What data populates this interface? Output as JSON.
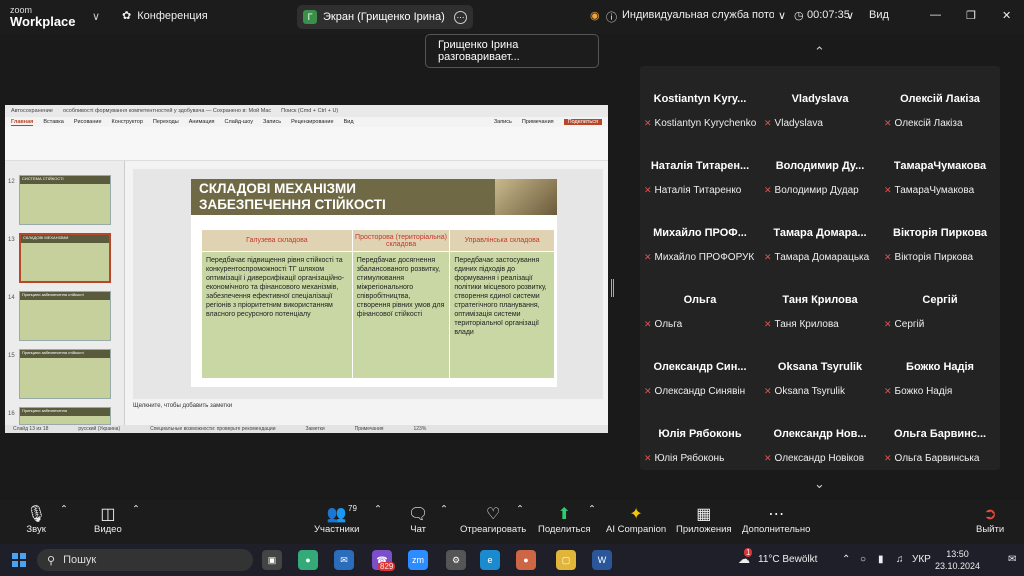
{
  "app": {
    "logo_top": "zoom",
    "logo_bottom": "Workplace",
    "meeting": "Конференция"
  },
  "screen_pill": {
    "label": "Экран (Грищенко Ірина)",
    "avatar": "Г"
  },
  "topright": {
    "service": "Индивидуальная служба потоково...",
    "timer": "00:07:35",
    "view": "Вид"
  },
  "speaking": "Грищенко Ірина разговаривает...",
  "ppt": {
    "autosave": "Автосохранение",
    "doc_title": "особливості формування компетентностей у здобувача — Сохранено в: Мой Mac",
    "search": "Поиск (Cmd + Ctrl + U)",
    "tabs": [
      "Главная",
      "Вставка",
      "Рисование",
      "Конструктор",
      "Переходы",
      "Анимация",
      "Слайд-шоу",
      "Запись",
      "Рецензирование",
      "Вид"
    ],
    "record": "Запись",
    "notes_btn": "Примечания",
    "share_btn": "Поделиться",
    "thumb_nums": [
      "12",
      "13",
      "14",
      "15",
      "16"
    ],
    "thumb_titles": [
      "СИСТЕМА СТІЙКОСТІ",
      "СКЛАДОВІ МЕХАНІЗМИ",
      "Принципи забезпечення стійкості",
      "Принципи забезпечення стійкості",
      "Принципи забезпечення"
    ],
    "slide_title": "СКЛАДОВІ МЕХАНІЗМИ ЗАБЕЗПЕЧЕННЯ СТІЙКОСТІ",
    "table_headers": [
      "Галузева складова",
      "Просторова (територіальна) складова",
      "Управлінська складова"
    ],
    "table_cells": [
      "Передбачає підвищення рівня стійкості та конкурентоспроможності ТГ шляхом оптимізації і диверсифікації організаційно-економічного та фінансового механізмів, забезпечення ефективної спеціалізації регіонів з пріоритетним використанням власного ресурсного потенціалу",
      "Передбачає досягнення збалансованого розвитку, стимулювання міжрегіонального співробітництва, створення рівних умов для фінансової стійкості",
      "Передбачає застосування єдиних підходів до формування і реалізації політики місцевого розвитку, створення єдиної системи стратегічного планування, оптимізація системи територіальної організації влади"
    ],
    "notes_hint": "Щелкните, чтобы добавить заметки",
    "status_slide": "Слайд 13 из 18",
    "status_lang": "русский (Украина)",
    "status_access": "Специальные возможности: проверьте рекомендации",
    "status_notes": "Заметки",
    "status_comments": "Примечания",
    "zoom": "123%"
  },
  "participants": [
    {
      "big": "Kostiantyn Kyry...",
      "small": "Kostiantyn Kyrychenko"
    },
    {
      "big": "Vladyslava",
      "small": "Vladyslava"
    },
    {
      "big": "Олексій Лакіза",
      "small": "Олексій Лакіза"
    },
    {
      "big": "Наталія Титарен...",
      "small": "Наталія Титаренко"
    },
    {
      "big": "Володимир Ду...",
      "small": "Володимир Дудар"
    },
    {
      "big": "ТамараЧумакова",
      "small": "ТамараЧумакова"
    },
    {
      "big": "Михайло ПРОФ...",
      "small": "Михайло ПРОФОРУК"
    },
    {
      "big": "Тамара Домара...",
      "small": "Тамара Домарацька"
    },
    {
      "big": "Вікторія Пиркова",
      "small": "Вікторія Пиркова"
    },
    {
      "big": "Ольга",
      "small": "Ольга"
    },
    {
      "big": "Таня Крилова",
      "small": "Таня Крилова"
    },
    {
      "big": "Сергій",
      "small": "Сергій"
    },
    {
      "big": "Олександр Син...",
      "small": "Олександр Синявін"
    },
    {
      "big": "Oksana Tsyrulik",
      "small": "Oksana Tsyrulik"
    },
    {
      "big": "Божко Надія",
      "small": "Божко Надія"
    },
    {
      "big": "Юлія Рябоконь",
      "small": "Юлія Рябоконь"
    },
    {
      "big": "Олександр Нов...",
      "small": "Олександр Новіков"
    },
    {
      "big": "Ольга Барвинс...",
      "small": "Ольга Барвинська"
    }
  ],
  "toolbar": {
    "sound": "Звук",
    "video": "Видео",
    "participants": "Участники",
    "participants_count": "79",
    "chat": "Чат",
    "react": "Отреагировать",
    "share": "Поделиться",
    "ai": "AI Companion",
    "apps": "Приложения",
    "more": "Дополнительно",
    "leave": "Выйти"
  },
  "taskbar": {
    "search": "Пошук",
    "weather": "11°C  Bewölkt",
    "weather_badge": "1",
    "lang": "УКР",
    "time": "13:50",
    "date": "23.10.2024",
    "viber_badge": "829"
  },
  "colors": {
    "slide_title_bg": "#6f6a45",
    "header_bg": "#e0d3b4",
    "cell_bg": "#c8d7a4",
    "header_text": "#c0392b",
    "accent_ppt": "#b7472a"
  }
}
